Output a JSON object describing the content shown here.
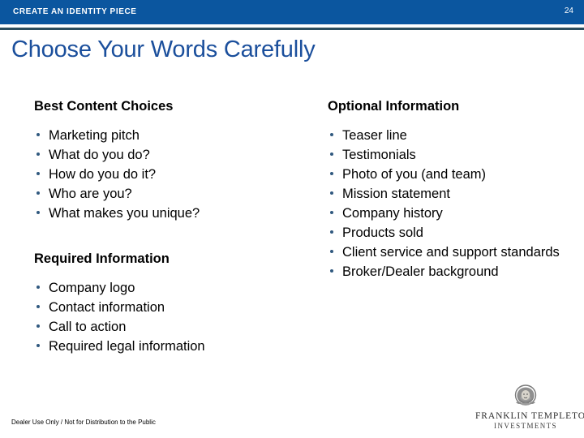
{
  "header": {
    "eyebrow_title": "CREATE AN IDENTITY PIECE",
    "page_number": "24",
    "bar_color": "#0b569f",
    "rule_color": "#2b4d5e"
  },
  "slide": {
    "title": "Choose Your Words Carefully",
    "title_color": "#1b4f9c",
    "bullet_color": "#30597f"
  },
  "columns": {
    "left": {
      "sections": [
        {
          "heading": "Best Content Choices",
          "items": [
            "Marketing pitch",
            "What do you do?",
            "How do you do it?",
            "Who are you?",
            "What makes you unique?"
          ]
        },
        {
          "heading": "Required Information",
          "items": [
            "Company logo",
            "Contact information",
            "Call to action",
            "Required legal information"
          ]
        }
      ]
    },
    "right": {
      "sections": [
        {
          "heading": "Optional Information",
          "items": [
            "Teaser line",
            "Testimonials",
            "Photo of you (and team)",
            "Mission statement",
            "Company history",
            "Products sold",
            "Client service and support standards",
            "Broker/Dealer background"
          ]
        }
      ]
    }
  },
  "footer": {
    "disclaimer": "Dealer Use Only / Not for Distribution to the Public"
  },
  "logo": {
    "medallion_alt": "benjamin-franklin-portrait-medallion",
    "name": "FRANKLIN TEMPLETON",
    "subtitle": "INVESTMENTS"
  }
}
